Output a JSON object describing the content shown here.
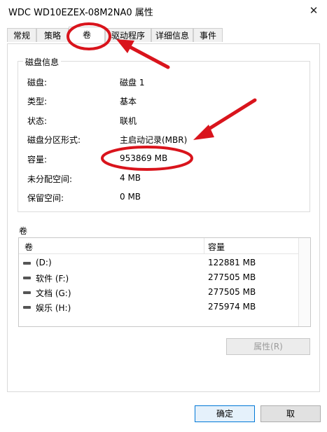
{
  "window": {
    "title": "WDC WD10EZEX-08M2NA0 属性",
    "close_glyph": "✕"
  },
  "tabs": [
    {
      "label": "常规"
    },
    {
      "label": "策略"
    },
    {
      "label": "卷"
    },
    {
      "label": "驱动程序"
    },
    {
      "label": "详细信息"
    },
    {
      "label": "事件"
    }
  ],
  "disk_info": {
    "title": "磁盘信息",
    "rows": [
      {
        "label": "磁盘:",
        "value": "磁盘 1"
      },
      {
        "label": "类型:",
        "value": "基本"
      },
      {
        "label": "状态:",
        "value": "联机"
      },
      {
        "label": "磁盘分区形式:",
        "value": "主启动记录(MBR)"
      },
      {
        "label": "容量:",
        "value": "953869 MB"
      },
      {
        "label": "未分配空间:",
        "value": "4 MB"
      },
      {
        "label": "保留空间:",
        "value": "0 MB"
      }
    ]
  },
  "volumes": {
    "label": "卷",
    "headers": {
      "name": "卷",
      "capacity": "容量"
    },
    "rows": [
      {
        "name": "(D:)",
        "capacity": "122881 MB"
      },
      {
        "name": "软件 (F:)",
        "capacity": "277505 MB"
      },
      {
        "name": "文档 (G:)",
        "capacity": "277505 MB"
      },
      {
        "name": "娱乐 (H:)",
        "capacity": "275974 MB"
      }
    ]
  },
  "buttons": {
    "properties": "属性(R)",
    "ok": "确定",
    "cancel": "取"
  },
  "colors": {
    "annotation": "#d9141c",
    "accent": "#0078d7"
  }
}
